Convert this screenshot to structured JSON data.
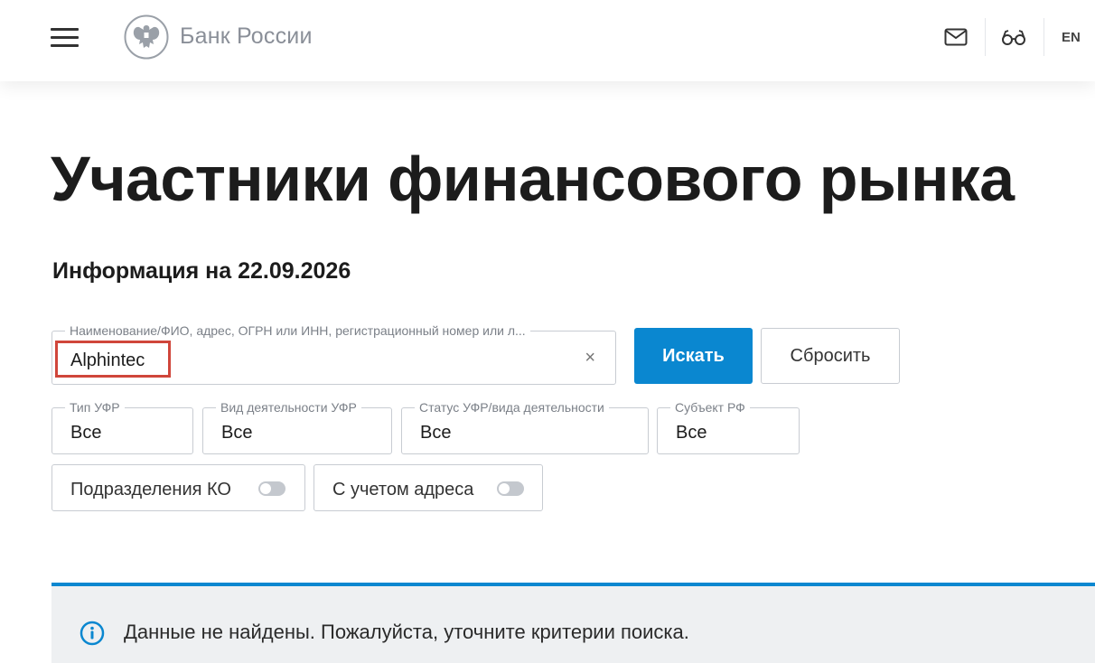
{
  "header": {
    "logo_text": "Банк России",
    "lang": "EN",
    "icons": [
      "menu-icon",
      "bank-emblem-icon",
      "mail-icon",
      "glasses-icon"
    ]
  },
  "page": {
    "title": "Участники финансового рынка",
    "info_date": "Информация на 22.09.2026"
  },
  "search": {
    "label": "Наименование/ФИО, адрес, ОГРН или ИНН, регистрационный номер или л...",
    "value": "Alphintec",
    "clear_symbol": "×",
    "search_button": "Искать",
    "reset_button": "Сбросить"
  },
  "filters": [
    {
      "label": "Тип УФР",
      "value": "Все"
    },
    {
      "label": "Вид деятельности УФР",
      "value": "Все"
    },
    {
      "label": "Статус УФР/вида деятельности",
      "value": "Все"
    },
    {
      "label": "Субъект РФ",
      "value": "Все"
    }
  ],
  "toggles": [
    {
      "label": "Подразделения КО",
      "on": false
    },
    {
      "label": "С учетом адреса",
      "on": false
    }
  ],
  "result": {
    "message": "Данные не найдены. Пожалуйста, уточните критерии поиска."
  },
  "colors": {
    "accent": "#0a87d0",
    "highlight": "#d0463b",
    "result_bg": "#eef0f2"
  }
}
